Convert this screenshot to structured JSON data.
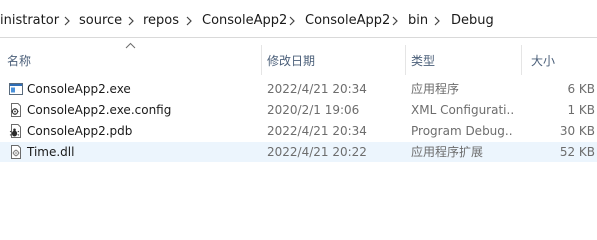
{
  "breadcrumb": {
    "segments": [
      "inistrator",
      "source",
      "repos",
      "ConsoleApp2",
      "ConsoleApp2",
      "bin",
      "Debug"
    ]
  },
  "columns": {
    "name": "名称",
    "date": "修改日期",
    "type": "类型",
    "size": "大小"
  },
  "files": [
    {
      "name": "ConsoleApp2.exe",
      "date": "2022/4/21 20:34",
      "type": "应用程序",
      "size": "6 KB",
      "icon": "exe-icon"
    },
    {
      "name": "ConsoleApp2.exe.config",
      "date": "2020/2/1 19:06",
      "type": "XML Configurati...",
      "size": "1 KB",
      "icon": "config-file-icon"
    },
    {
      "name": "ConsoleApp2.pdb",
      "date": "2022/4/21 20:34",
      "type": "Program Debug...",
      "size": "30 KB",
      "icon": "pdb-file-icon"
    },
    {
      "name": "Time.dll",
      "date": "2022/4/21 20:22",
      "type": "应用程序扩展",
      "size": "52 KB",
      "icon": "dll-file-icon"
    }
  ],
  "colors": {
    "selected_row": "#ecf5fd",
    "header_text": "#4c607a",
    "detail_text": "#6d6d6d"
  }
}
